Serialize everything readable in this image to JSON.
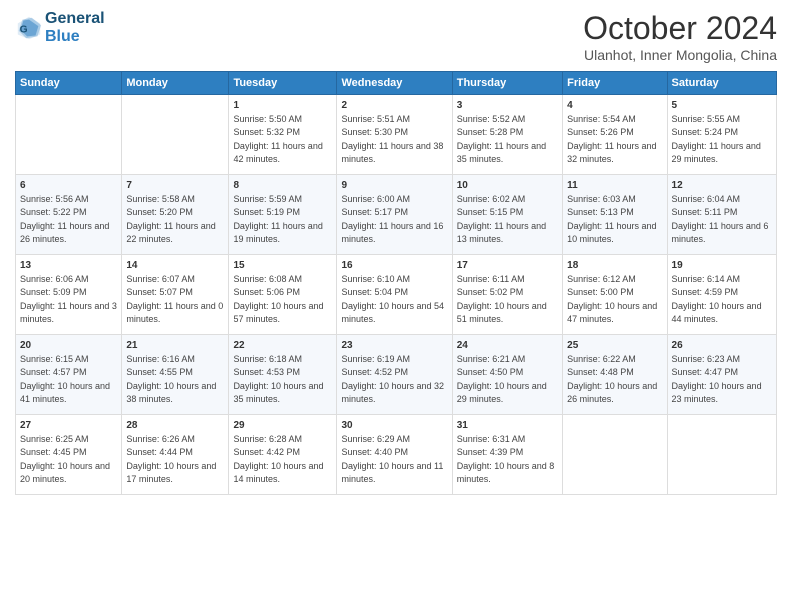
{
  "header": {
    "logo_line1": "General",
    "logo_line2": "Blue",
    "month": "October 2024",
    "location": "Ulanhot, Inner Mongolia, China"
  },
  "days_of_week": [
    "Sunday",
    "Monday",
    "Tuesday",
    "Wednesday",
    "Thursday",
    "Friday",
    "Saturday"
  ],
  "weeks": [
    [
      {
        "day": "",
        "sunrise": "",
        "sunset": "",
        "daylight": ""
      },
      {
        "day": "",
        "sunrise": "",
        "sunset": "",
        "daylight": ""
      },
      {
        "day": "1",
        "sunrise": "Sunrise: 5:50 AM",
        "sunset": "Sunset: 5:32 PM",
        "daylight": "Daylight: 11 hours and 42 minutes."
      },
      {
        "day": "2",
        "sunrise": "Sunrise: 5:51 AM",
        "sunset": "Sunset: 5:30 PM",
        "daylight": "Daylight: 11 hours and 38 minutes."
      },
      {
        "day": "3",
        "sunrise": "Sunrise: 5:52 AM",
        "sunset": "Sunset: 5:28 PM",
        "daylight": "Daylight: 11 hours and 35 minutes."
      },
      {
        "day": "4",
        "sunrise": "Sunrise: 5:54 AM",
        "sunset": "Sunset: 5:26 PM",
        "daylight": "Daylight: 11 hours and 32 minutes."
      },
      {
        "day": "5",
        "sunrise": "Sunrise: 5:55 AM",
        "sunset": "Sunset: 5:24 PM",
        "daylight": "Daylight: 11 hours and 29 minutes."
      }
    ],
    [
      {
        "day": "6",
        "sunrise": "Sunrise: 5:56 AM",
        "sunset": "Sunset: 5:22 PM",
        "daylight": "Daylight: 11 hours and 26 minutes."
      },
      {
        "day": "7",
        "sunrise": "Sunrise: 5:58 AM",
        "sunset": "Sunset: 5:20 PM",
        "daylight": "Daylight: 11 hours and 22 minutes."
      },
      {
        "day": "8",
        "sunrise": "Sunrise: 5:59 AM",
        "sunset": "Sunset: 5:19 PM",
        "daylight": "Daylight: 11 hours and 19 minutes."
      },
      {
        "day": "9",
        "sunrise": "Sunrise: 6:00 AM",
        "sunset": "Sunset: 5:17 PM",
        "daylight": "Daylight: 11 hours and 16 minutes."
      },
      {
        "day": "10",
        "sunrise": "Sunrise: 6:02 AM",
        "sunset": "Sunset: 5:15 PM",
        "daylight": "Daylight: 11 hours and 13 minutes."
      },
      {
        "day": "11",
        "sunrise": "Sunrise: 6:03 AM",
        "sunset": "Sunset: 5:13 PM",
        "daylight": "Daylight: 11 hours and 10 minutes."
      },
      {
        "day": "12",
        "sunrise": "Sunrise: 6:04 AM",
        "sunset": "Sunset: 5:11 PM",
        "daylight": "Daylight: 11 hours and 6 minutes."
      }
    ],
    [
      {
        "day": "13",
        "sunrise": "Sunrise: 6:06 AM",
        "sunset": "Sunset: 5:09 PM",
        "daylight": "Daylight: 11 hours and 3 minutes."
      },
      {
        "day": "14",
        "sunrise": "Sunrise: 6:07 AM",
        "sunset": "Sunset: 5:07 PM",
        "daylight": "Daylight: 11 hours and 0 minutes."
      },
      {
        "day": "15",
        "sunrise": "Sunrise: 6:08 AM",
        "sunset": "Sunset: 5:06 PM",
        "daylight": "Daylight: 10 hours and 57 minutes."
      },
      {
        "day": "16",
        "sunrise": "Sunrise: 6:10 AM",
        "sunset": "Sunset: 5:04 PM",
        "daylight": "Daylight: 10 hours and 54 minutes."
      },
      {
        "day": "17",
        "sunrise": "Sunrise: 6:11 AM",
        "sunset": "Sunset: 5:02 PM",
        "daylight": "Daylight: 10 hours and 51 minutes."
      },
      {
        "day": "18",
        "sunrise": "Sunrise: 6:12 AM",
        "sunset": "Sunset: 5:00 PM",
        "daylight": "Daylight: 10 hours and 47 minutes."
      },
      {
        "day": "19",
        "sunrise": "Sunrise: 6:14 AM",
        "sunset": "Sunset: 4:59 PM",
        "daylight": "Daylight: 10 hours and 44 minutes."
      }
    ],
    [
      {
        "day": "20",
        "sunrise": "Sunrise: 6:15 AM",
        "sunset": "Sunset: 4:57 PM",
        "daylight": "Daylight: 10 hours and 41 minutes."
      },
      {
        "day": "21",
        "sunrise": "Sunrise: 6:16 AM",
        "sunset": "Sunset: 4:55 PM",
        "daylight": "Daylight: 10 hours and 38 minutes."
      },
      {
        "day": "22",
        "sunrise": "Sunrise: 6:18 AM",
        "sunset": "Sunset: 4:53 PM",
        "daylight": "Daylight: 10 hours and 35 minutes."
      },
      {
        "day": "23",
        "sunrise": "Sunrise: 6:19 AM",
        "sunset": "Sunset: 4:52 PM",
        "daylight": "Daylight: 10 hours and 32 minutes."
      },
      {
        "day": "24",
        "sunrise": "Sunrise: 6:21 AM",
        "sunset": "Sunset: 4:50 PM",
        "daylight": "Daylight: 10 hours and 29 minutes."
      },
      {
        "day": "25",
        "sunrise": "Sunrise: 6:22 AM",
        "sunset": "Sunset: 4:48 PM",
        "daylight": "Daylight: 10 hours and 26 minutes."
      },
      {
        "day": "26",
        "sunrise": "Sunrise: 6:23 AM",
        "sunset": "Sunset: 4:47 PM",
        "daylight": "Daylight: 10 hours and 23 minutes."
      }
    ],
    [
      {
        "day": "27",
        "sunrise": "Sunrise: 6:25 AM",
        "sunset": "Sunset: 4:45 PM",
        "daylight": "Daylight: 10 hours and 20 minutes."
      },
      {
        "day": "28",
        "sunrise": "Sunrise: 6:26 AM",
        "sunset": "Sunset: 4:44 PM",
        "daylight": "Daylight: 10 hours and 17 minutes."
      },
      {
        "day": "29",
        "sunrise": "Sunrise: 6:28 AM",
        "sunset": "Sunset: 4:42 PM",
        "daylight": "Daylight: 10 hours and 14 minutes."
      },
      {
        "day": "30",
        "sunrise": "Sunrise: 6:29 AM",
        "sunset": "Sunset: 4:40 PM",
        "daylight": "Daylight: 10 hours and 11 minutes."
      },
      {
        "day": "31",
        "sunrise": "Sunrise: 6:31 AM",
        "sunset": "Sunset: 4:39 PM",
        "daylight": "Daylight: 10 hours and 8 minutes."
      },
      {
        "day": "",
        "sunrise": "",
        "sunset": "",
        "daylight": ""
      },
      {
        "day": "",
        "sunrise": "",
        "sunset": "",
        "daylight": ""
      }
    ]
  ]
}
